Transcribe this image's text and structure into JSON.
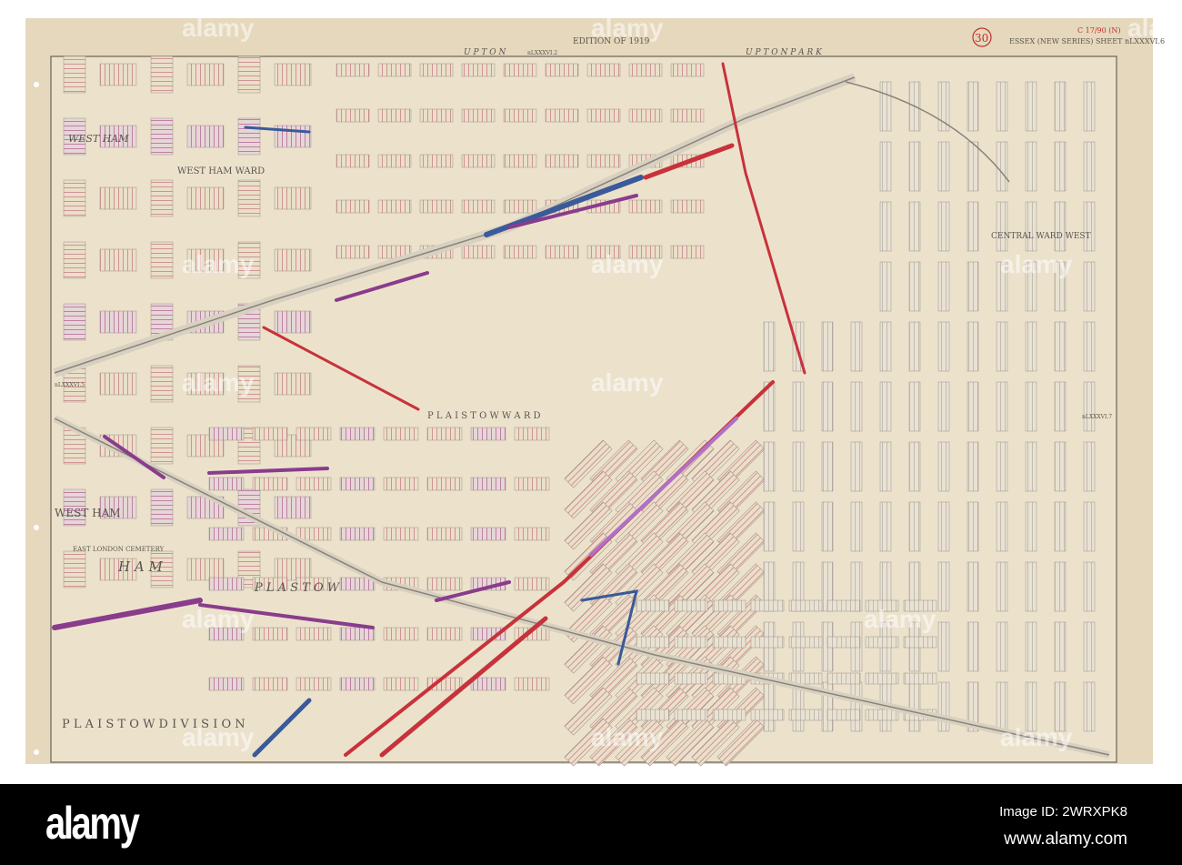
{
  "map": {
    "edition": "EDITION OF 1919",
    "sheet": "ESSEX (NEW SERIES)  SHEET nLXXXVI.6",
    "sheet_number_circle": "30",
    "catalogue_mark": "C 17/90 (N)",
    "adjacent_sheets": {
      "top": "nLXXXVI.2",
      "left": "nLXXXVI.5",
      "right": "nLXXXVI.7"
    },
    "labels": {
      "upton": "U P T O N",
      "upton_park": "U P T O N   P A R K",
      "west_ham_ward": "WEST HAM WARD",
      "central_ward_west": "CENTRAL WARD WEST",
      "plaistow_ward": "P L A I S T O W   W A R D",
      "west_ham": "WEST HAM",
      "east_london_cemetery": "EAST LONDON CEMETERY",
      "ham": "H  A  M",
      "plaistow": "P L A S T O W",
      "plaistow_division": "P L A I S T O W   D I V I S I O N",
      "west_ham_top": "WEST HAM"
    },
    "colors": {
      "paper": "#e8dcc4",
      "red": "#c8323a",
      "pink": "#c8788a",
      "purple": "#8a3c8c",
      "blue": "#3a5a9a",
      "violet": "#b070c8"
    }
  },
  "watermark": "alamy",
  "footer": {
    "logo": "alamy",
    "image_id": "Image ID: 2WRXPK8",
    "website": "www.alamy.com"
  }
}
